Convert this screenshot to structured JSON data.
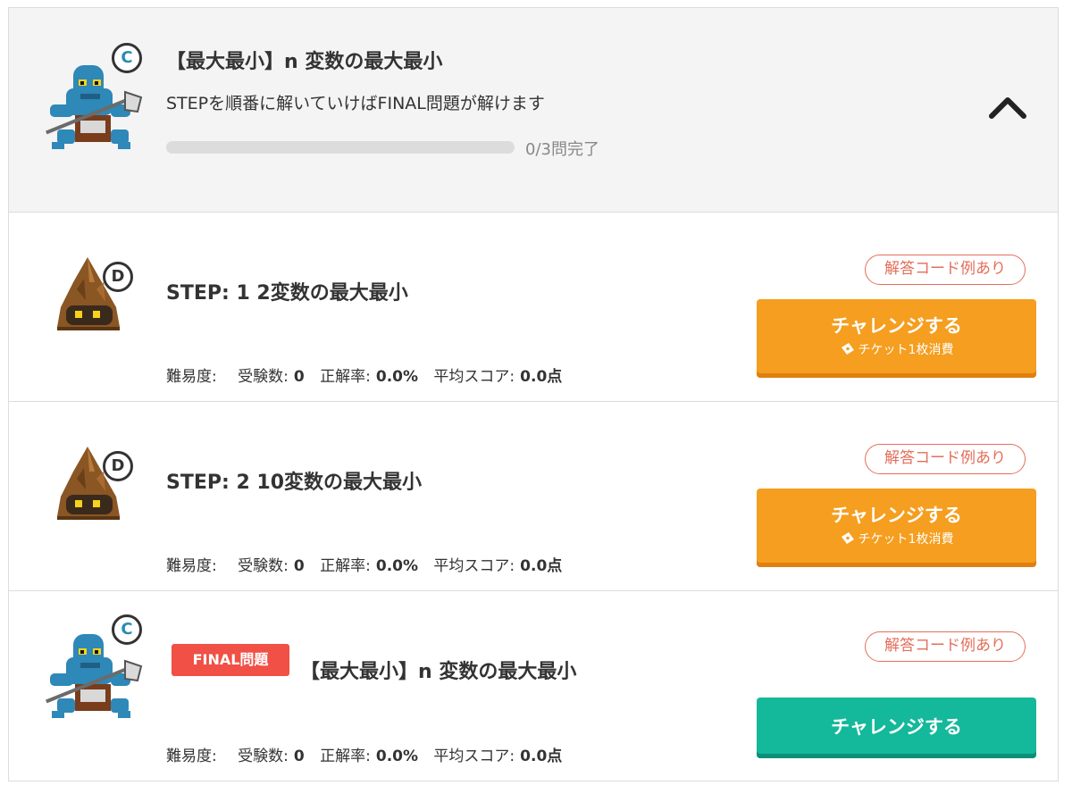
{
  "header": {
    "title": "【最大最小】n 変数の最大最小",
    "subtitle": "STEPを順番に解いていけばFINAL問題が解けます",
    "progress_value": 0,
    "progress_text": "0/3問完了",
    "rank": "C",
    "toggle_icon": "chevron-up-icon"
  },
  "steps": [
    {
      "rank": "D",
      "title": "STEP: 1 2変数の最大最小",
      "answer_badge": "解答コード例あり",
      "stats": {
        "difficulty_label": "難易度:",
        "examinees_label": "受験数:",
        "examinees_value": "0",
        "accuracy_label": "正解率:",
        "accuracy_value": "0.0%",
        "avg_score_label": "平均スコア:",
        "avg_score_value": "0.0点"
      },
      "button_label": "チャレンジする",
      "button_sub": "チケット1枚消費"
    },
    {
      "rank": "D",
      "title": "STEP: 2 10変数の最大最小",
      "answer_badge": "解答コード例あり",
      "stats": {
        "difficulty_label": "難易度:",
        "examinees_label": "受験数:",
        "examinees_value": "0",
        "accuracy_label": "正解率:",
        "accuracy_value": "0.0%",
        "avg_score_label": "平均スコア:",
        "avg_score_value": "0.0点"
      },
      "button_label": "チャレンジする",
      "button_sub": "チケット1枚消費"
    }
  ],
  "final": {
    "rank": "C",
    "tag": "FINAL問題",
    "title": "【最大最小】n 変数の最大最小",
    "answer_badge": "解答コード例あり",
    "stats": {
      "difficulty_label": "難易度:",
      "examinees_label": "受験数:",
      "examinees_value": "0",
      "accuracy_label": "正解率:",
      "accuracy_value": "0.0%",
      "avg_score_label": "平均スコア:",
      "avg_score_value": "0.0点"
    },
    "button_label": "チャレンジする"
  },
  "colors": {
    "accent_orange": "#f59e1f",
    "accent_green": "#14b89a",
    "final_tag_red": "#f05045",
    "answer_badge_red": "#e46e5a",
    "header_bg": "#f4f4f4"
  }
}
